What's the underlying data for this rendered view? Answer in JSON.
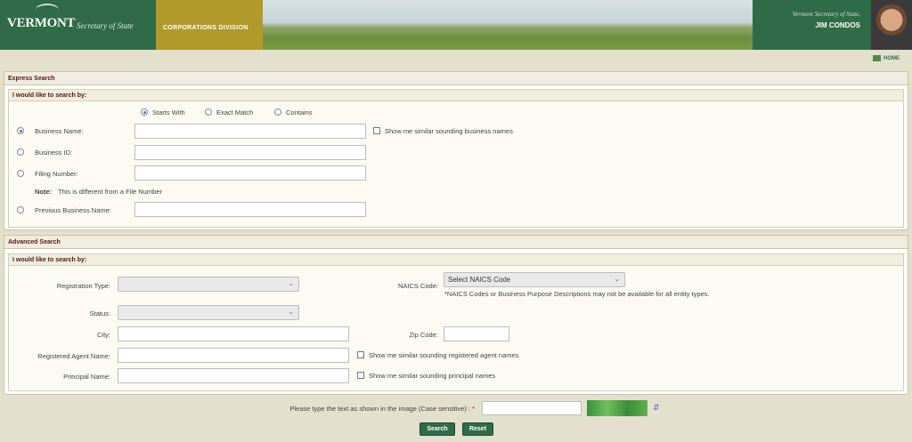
{
  "banner": {
    "state": "VERMONT",
    "office": "Secretary of State",
    "division": "CORPORATIONS DIVISION",
    "official_title": "Vermont Secretary of State,",
    "official_name": "JIM CONDOS"
  },
  "nav": {
    "home": "HOME"
  },
  "express": {
    "title": "Express Search",
    "subtitle": "I would like to search by:",
    "match_options": [
      "Starts With",
      "Exact Match",
      "Contains"
    ],
    "fields": {
      "business_name": "Business Name:",
      "business_id": "Business ID:",
      "filing_number": "Filing Number:",
      "previous_name": "Previous Business Name:"
    },
    "similar_label": "Show me similar sounding business names",
    "note_label": "Note:",
    "note_text": "This is different from a File Number"
  },
  "advanced": {
    "title": "Advanced Search",
    "subtitle": "I would like to search by:",
    "registration_type_label": "Registration Type:",
    "status_label": "Status:",
    "city_label": "City:",
    "agent_label": "Registered Agent Name:",
    "principal_label": "Principal Name:",
    "naics_label": "NAICS Code:",
    "naics_select": "Select NAICS Code",
    "naics_note": "*NAICS Codes or Business Purpose Descriptions may not be available for all entity types.",
    "zip_label": "Zip Code:",
    "agent_similar": "Show me similar sounding registered agent names",
    "principal_similar": "Show me similar sounding principal names"
  },
  "captcha": {
    "prompt": "Please type the text as shown in the image (Case sensitive) :",
    "required": "*"
  },
  "buttons": {
    "search": "Search",
    "reset": "Reset"
  },
  "colors": {
    "brand_green": "#2f6b47",
    "gold": "#b19a2a",
    "heading": "#5a1414"
  }
}
